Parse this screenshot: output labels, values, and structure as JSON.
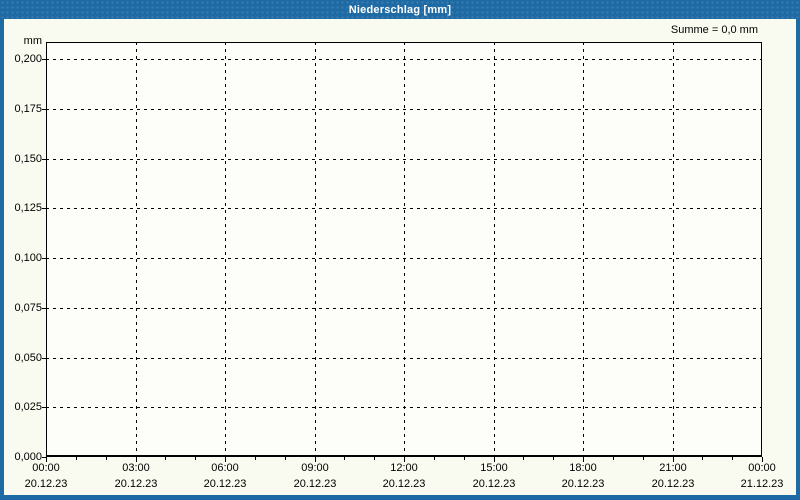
{
  "window": {
    "title": "Niederschlag [mm]"
  },
  "header": {
    "sum_label": "Summe = 0,0 mm"
  },
  "colors": {
    "accent_blue": "#1e6aa4",
    "background": "#fafbf0",
    "plot_background": "#fdfdfa",
    "grid": "#000000",
    "title_text": "#ffffff"
  },
  "chart_data": {
    "type": "bar",
    "title": "Niederschlag [mm]",
    "ylabel_unit": "mm",
    "sum_text": "Summe = 0,0 mm",
    "sum_mm": 0.0,
    "ylim": [
      0,
      0.2085
    ],
    "xlim_hours": [
      0,
      24
    ],
    "grid": true,
    "minor_x_tick_every_hours": 1,
    "major_x_tick_every_hours": 3,
    "series": [
      {
        "name": "Niederschlag",
        "values": []
      }
    ],
    "y_ticks": [
      {
        "label": "0,200",
        "value": 0.2
      },
      {
        "label": "0,175",
        "value": 0.175
      },
      {
        "label": "0,150",
        "value": 0.15
      },
      {
        "label": "0,125",
        "value": 0.125
      },
      {
        "label": "0,100",
        "value": 0.1
      },
      {
        "label": "0,075",
        "value": 0.075
      },
      {
        "label": "0,050",
        "value": 0.05
      },
      {
        "label": "0,025",
        "value": 0.025
      },
      {
        "label": "0,000",
        "value": 0.0
      }
    ],
    "x_ticks": [
      {
        "hour": 0,
        "time": "00:00",
        "date": "20.12.23"
      },
      {
        "hour": 3,
        "time": "03:00",
        "date": "20.12.23"
      },
      {
        "hour": 6,
        "time": "06:00",
        "date": "20.12.23"
      },
      {
        "hour": 9,
        "time": "09:00",
        "date": "20.12.23"
      },
      {
        "hour": 12,
        "time": "12:00",
        "date": "20.12.23"
      },
      {
        "hour": 15,
        "time": "15:00",
        "date": "20.12.23"
      },
      {
        "hour": 18,
        "time": "18:00",
        "date": "20.12.23"
      },
      {
        "hour": 21,
        "time": "21:00",
        "date": "20.12.23"
      },
      {
        "hour": 24,
        "time": "00:00",
        "date": "21.12.23"
      }
    ]
  }
}
